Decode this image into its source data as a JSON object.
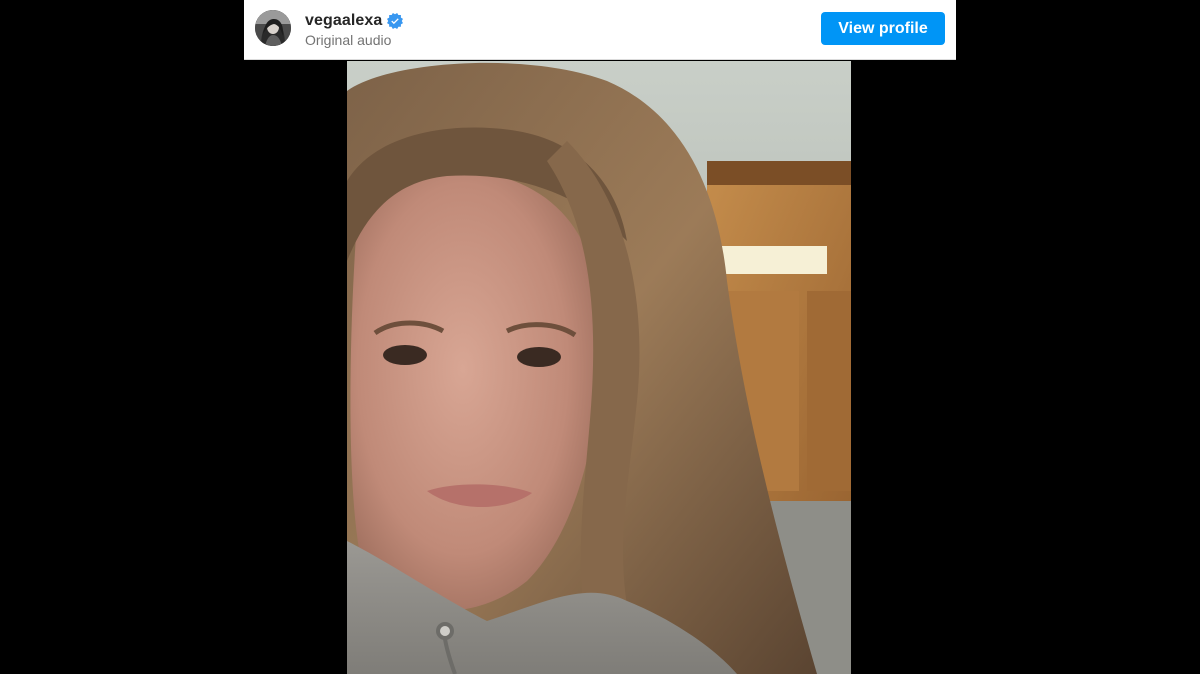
{
  "post": {
    "username": "vegaalexa",
    "verified": true,
    "audio_label": "Original audio",
    "view_profile_label": "View profile"
  },
  "icons": {
    "verified": "verified-badge-icon",
    "avatar": "profile-avatar"
  },
  "colors": {
    "accent": "#0095f6",
    "verified": "#3897f0",
    "username": "#262626",
    "subtitle": "#737373",
    "letterbox": "#000000"
  }
}
